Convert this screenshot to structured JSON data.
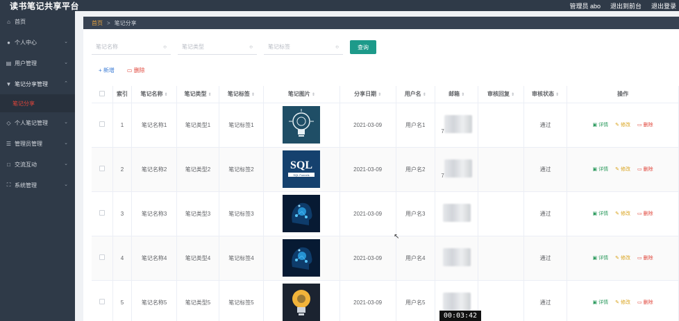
{
  "app": {
    "title": "读书笔记共享平台"
  },
  "topbar": {
    "admin_label": "管理员 abo",
    "to_front": "退出到前台",
    "logout": "退出登录"
  },
  "sidebar": {
    "items": [
      {
        "label": "首页",
        "icon": "home-icon"
      },
      {
        "label": "个人中心",
        "icon": "user-icon"
      },
      {
        "label": "用户管理",
        "icon": "chart-icon"
      },
      {
        "label": "笔记分享管理",
        "icon": "shield-icon"
      },
      {
        "label": "个人笔记管理",
        "icon": "tag-icon"
      },
      {
        "label": "管理员管理",
        "icon": "list-icon"
      },
      {
        "label": "交流互动",
        "icon": "chat-icon"
      },
      {
        "label": "系统管理",
        "icon": "settings-icon"
      }
    ],
    "submenu_active": "笔记分享"
  },
  "breadcrumb": {
    "home": "首页",
    "separator": ">",
    "current": "笔记分享"
  },
  "filters": {
    "name_placeholder": "笔记名称",
    "type_placeholder": "笔记类型",
    "tag_placeholder": "笔记标签",
    "query_label": "查询"
  },
  "actions": {
    "add_label": "新增",
    "delete_label": "删除"
  },
  "table": {
    "headers": [
      "",
      "索引",
      "笔记名称",
      "笔记类型",
      "笔记标签",
      "笔记图片",
      "分享日期",
      "用户名",
      "邮箱",
      "审核回复",
      "审核状态",
      "操作"
    ],
    "op_labels": {
      "detail": "详情",
      "edit": "修改",
      "delete": "删除"
    },
    "rows": [
      {
        "index": "1",
        "name": "笔记名称1",
        "type": "笔记类型1",
        "tag": "笔记标签1",
        "date": "2021-03-09",
        "user": "用户名1",
        "email_prefix": "7",
        "reply": "",
        "status": "通过",
        "image": "bulb"
      },
      {
        "index": "2",
        "name": "笔记名称2",
        "type": "笔记类型2",
        "tag": "笔记标签2",
        "date": "2021-03-09",
        "user": "用户名2",
        "email_prefix": "7",
        "reply": "",
        "status": "通过",
        "image": "sql"
      },
      {
        "index": "3",
        "name": "笔记名称3",
        "type": "笔记类型3",
        "tag": "笔记标签3",
        "date": "2021-03-09",
        "user": "用户名3",
        "email_prefix": "",
        "reply": "",
        "status": "通过",
        "image": "ai"
      },
      {
        "index": "4",
        "name": "笔记名称4",
        "type": "笔记类型4",
        "tag": "笔记标签4",
        "date": "2021-03-09",
        "user": "用户名4",
        "email_prefix": "",
        "reply": "",
        "status": "通过",
        "image": "ai"
      },
      {
        "index": "5",
        "name": "笔记名称5",
        "type": "笔记类型5",
        "tag": "笔记标签5",
        "date": "2021-03-09",
        "user": "用户名5",
        "email_prefix": "",
        "reply": "",
        "status": "通过",
        "image": "bulb2"
      }
    ]
  },
  "image_text": {
    "sql_title": "SQL",
    "sql_caption": "SQL Funnels"
  },
  "overlay": {
    "timer": "00:03:42"
  },
  "colors": {
    "sidebar_bg": "#2f3a48",
    "accent": "#1d9a8a",
    "danger": "#e0453a",
    "warning": "#d9a21a",
    "success": "#2e9b5f"
  }
}
